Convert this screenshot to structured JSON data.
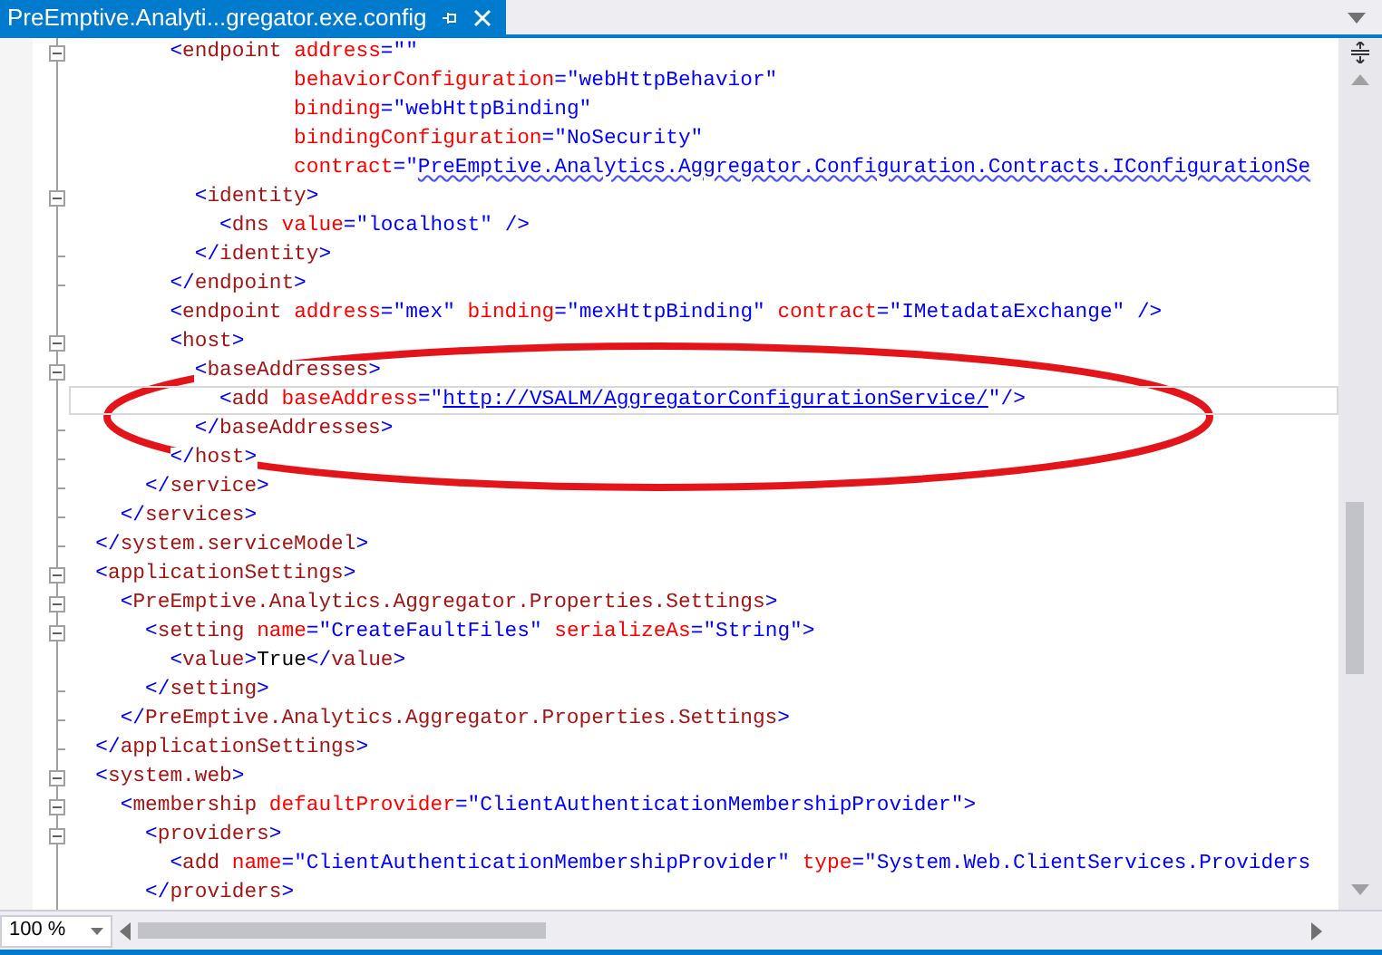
{
  "tab": {
    "title": "PreEmptive.Analyti...gregator.exe.config",
    "selected": true
  },
  "lines": [
    {
      "kind": "collapsible",
      "current": false,
      "tokens": [
        {
          "kind": "punct",
          "text": "        <"
        },
        {
          "kind": "name",
          "text": "endpoint"
        },
        {
          "kind": "attr",
          "text": " address"
        },
        {
          "kind": "punct",
          "text": "="
        },
        {
          "kind": "value",
          "text": "\"\""
        }
      ]
    },
    {
      "kind": "plain",
      "current": false,
      "tokens": [
        {
          "kind": "attr",
          "text": "                  behaviorConfiguration"
        },
        {
          "kind": "punct",
          "text": "="
        },
        {
          "kind": "value",
          "text": "\"webHttpBehavior\""
        }
      ]
    },
    {
      "kind": "plain",
      "current": false,
      "tokens": [
        {
          "kind": "attr",
          "text": "                  binding"
        },
        {
          "kind": "punct",
          "text": "="
        },
        {
          "kind": "value",
          "text": "\"webHttpBinding\""
        }
      ]
    },
    {
      "kind": "plain",
      "current": false,
      "tokens": [
        {
          "kind": "attr",
          "text": "                  bindingConfiguration"
        },
        {
          "kind": "punct",
          "text": "="
        },
        {
          "kind": "value",
          "text": "\"NoSecurity\""
        }
      ]
    },
    {
      "kind": "plain",
      "current": false,
      "tokens": [
        {
          "kind": "attr",
          "text": "                  contract"
        },
        {
          "kind": "punct",
          "text": "="
        },
        {
          "kind": "value",
          "text": "\""
        },
        {
          "kind": "error",
          "text": "PreEmptive.Analytics.Aggregator.Configuration.Contracts.IConfigurationSe"
        }
      ]
    },
    {
      "kind": "collapsible",
      "current": false,
      "tokens": [
        {
          "kind": "punct",
          "text": "          <"
        },
        {
          "kind": "name",
          "text": "identity"
        },
        {
          "kind": "punct",
          "text": ">"
        }
      ]
    },
    {
      "kind": "plain",
      "current": false,
      "tokens": [
        {
          "kind": "punct",
          "text": "            <"
        },
        {
          "kind": "name",
          "text": "dns"
        },
        {
          "kind": "attr",
          "text": " value"
        },
        {
          "kind": "punct",
          "text": "="
        },
        {
          "kind": "value",
          "text": "\"localhost\""
        },
        {
          "kind": "punct",
          "text": " />"
        }
      ]
    },
    {
      "kind": "closing",
      "current": false,
      "tokens": [
        {
          "kind": "punct",
          "text": "          </"
        },
        {
          "kind": "name",
          "text": "identity"
        },
        {
          "kind": "punct",
          "text": ">"
        }
      ]
    },
    {
      "kind": "closing",
      "current": false,
      "tokens": [
        {
          "kind": "punct",
          "text": "        </"
        },
        {
          "kind": "name",
          "text": "endpoint"
        },
        {
          "kind": "punct",
          "text": ">"
        }
      ]
    },
    {
      "kind": "plain",
      "current": false,
      "tokens": [
        {
          "kind": "punct",
          "text": "        <"
        },
        {
          "kind": "name",
          "text": "endpoint"
        },
        {
          "kind": "attr",
          "text": " address"
        },
        {
          "kind": "punct",
          "text": "="
        },
        {
          "kind": "value",
          "text": "\"mex\""
        },
        {
          "kind": "attr",
          "text": " binding"
        },
        {
          "kind": "punct",
          "text": "="
        },
        {
          "kind": "value",
          "text": "\"mexHttpBinding\""
        },
        {
          "kind": "attr",
          "text": " contract"
        },
        {
          "kind": "punct",
          "text": "="
        },
        {
          "kind": "value",
          "text": "\"IMetadataExchange\""
        },
        {
          "kind": "punct",
          "text": " />"
        }
      ]
    },
    {
      "kind": "collapsible",
      "current": false,
      "tokens": [
        {
          "kind": "punct",
          "text": "        <"
        },
        {
          "kind": "name",
          "text": "host"
        },
        {
          "kind": "punct",
          "text": ">"
        }
      ]
    },
    {
      "kind": "collapsible",
      "current": false,
      "tokens": [
        {
          "kind": "punct",
          "text": "          <"
        },
        {
          "kind": "name",
          "text": "baseAddresses"
        },
        {
          "kind": "punct",
          "text": ">"
        }
      ]
    },
    {
      "kind": "plain",
      "current": true,
      "tokens": [
        {
          "kind": "punct",
          "text": "            <"
        },
        {
          "kind": "name",
          "text": "add"
        },
        {
          "kind": "attr",
          "text": " baseAddress"
        },
        {
          "kind": "punct",
          "text": "="
        },
        {
          "kind": "value",
          "text": "\""
        },
        {
          "kind": "link",
          "text": "http://VSALM/AggregatorConfigurationService/"
        },
        {
          "kind": "value",
          "text": "\""
        },
        {
          "kind": "punct",
          "text": "/>"
        }
      ]
    },
    {
      "kind": "closing",
      "current": false,
      "tokens": [
        {
          "kind": "punct",
          "text": "          </"
        },
        {
          "kind": "name",
          "text": "baseAddresses"
        },
        {
          "kind": "punct",
          "text": ">"
        }
      ]
    },
    {
      "kind": "closing",
      "current": false,
      "tokens": [
        {
          "kind": "punct",
          "text": "        </"
        },
        {
          "kind": "name",
          "text": "host"
        },
        {
          "kind": "punct",
          "text": ">"
        }
      ]
    },
    {
      "kind": "closing",
      "current": false,
      "tokens": [
        {
          "kind": "punct",
          "text": "      </"
        },
        {
          "kind": "name",
          "text": "service"
        },
        {
          "kind": "punct",
          "text": ">"
        }
      ]
    },
    {
      "kind": "closing",
      "current": false,
      "tokens": [
        {
          "kind": "punct",
          "text": "    </"
        },
        {
          "kind": "name",
          "text": "services"
        },
        {
          "kind": "punct",
          "text": ">"
        }
      ]
    },
    {
      "kind": "closing",
      "current": false,
      "tokens": [
        {
          "kind": "punct",
          "text": "  </"
        },
        {
          "kind": "name",
          "text": "system.serviceModel"
        },
        {
          "kind": "punct",
          "text": ">"
        }
      ]
    },
    {
      "kind": "collapsible",
      "current": false,
      "tokens": [
        {
          "kind": "punct",
          "text": "  <"
        },
        {
          "kind": "name",
          "text": "applicationSettings"
        },
        {
          "kind": "punct",
          "text": ">"
        }
      ]
    },
    {
      "kind": "collapsible",
      "current": false,
      "tokens": [
        {
          "kind": "punct",
          "text": "    <"
        },
        {
          "kind": "name",
          "text": "PreEmptive.Analytics.Aggregator.Properties.Settings"
        },
        {
          "kind": "punct",
          "text": ">"
        }
      ]
    },
    {
      "kind": "collapsible",
      "current": false,
      "tokens": [
        {
          "kind": "punct",
          "text": "      <"
        },
        {
          "kind": "name",
          "text": "setting"
        },
        {
          "kind": "attr",
          "text": " name"
        },
        {
          "kind": "punct",
          "text": "="
        },
        {
          "kind": "value",
          "text": "\"CreateFaultFiles\""
        },
        {
          "kind": "attr",
          "text": " serializeAs"
        },
        {
          "kind": "punct",
          "text": "="
        },
        {
          "kind": "value",
          "text": "\"String\""
        },
        {
          "kind": "punct",
          "text": ">"
        }
      ]
    },
    {
      "kind": "plain",
      "current": false,
      "tokens": [
        {
          "kind": "punct",
          "text": "        <"
        },
        {
          "kind": "name",
          "text": "value"
        },
        {
          "kind": "punct",
          "text": ">"
        },
        {
          "kind": "text",
          "text": "True"
        },
        {
          "kind": "punct",
          "text": "</"
        },
        {
          "kind": "name",
          "text": "value"
        },
        {
          "kind": "punct",
          "text": ">"
        }
      ]
    },
    {
      "kind": "closing",
      "current": false,
      "tokens": [
        {
          "kind": "punct",
          "text": "      </"
        },
        {
          "kind": "name",
          "text": "setting"
        },
        {
          "kind": "punct",
          "text": ">"
        }
      ]
    },
    {
      "kind": "closing",
      "current": false,
      "tokens": [
        {
          "kind": "punct",
          "text": "    </"
        },
        {
          "kind": "name",
          "text": "PreEmptive.Analytics.Aggregator.Properties.Settings"
        },
        {
          "kind": "punct",
          "text": ">"
        }
      ]
    },
    {
      "kind": "closing",
      "current": false,
      "tokens": [
        {
          "kind": "punct",
          "text": "  </"
        },
        {
          "kind": "name",
          "text": "applicationSettings"
        },
        {
          "kind": "punct",
          "text": ">"
        }
      ]
    },
    {
      "kind": "collapsible",
      "current": false,
      "tokens": [
        {
          "kind": "punct",
          "text": "  <"
        },
        {
          "kind": "name",
          "text": "system.web"
        },
        {
          "kind": "punct",
          "text": ">"
        }
      ]
    },
    {
      "kind": "collapsible",
      "current": false,
      "tokens": [
        {
          "kind": "punct",
          "text": "    <"
        },
        {
          "kind": "name",
          "text": "membership"
        },
        {
          "kind": "attr",
          "text": " defaultProvider"
        },
        {
          "kind": "punct",
          "text": "="
        },
        {
          "kind": "value",
          "text": "\"ClientAuthenticationMembershipProvider\""
        },
        {
          "kind": "punct",
          "text": ">"
        }
      ]
    },
    {
      "kind": "collapsible",
      "current": false,
      "tokens": [
        {
          "kind": "punct",
          "text": "      <"
        },
        {
          "kind": "name",
          "text": "providers"
        },
        {
          "kind": "punct",
          "text": ">"
        }
      ]
    },
    {
      "kind": "plain",
      "current": false,
      "tokens": [
        {
          "kind": "punct",
          "text": "        <"
        },
        {
          "kind": "name",
          "text": "add"
        },
        {
          "kind": "attr",
          "text": " name"
        },
        {
          "kind": "punct",
          "text": "="
        },
        {
          "kind": "value",
          "text": "\"ClientAuthenticationMembershipProvider\""
        },
        {
          "kind": "attr",
          "text": " type"
        },
        {
          "kind": "punct",
          "text": "="
        },
        {
          "kind": "value",
          "text": "\"System.Web.ClientServices.Providers"
        }
      ]
    },
    {
      "kind": "plain",
      "current": false,
      "tokens": [
        {
          "kind": "punct",
          "text": "      </"
        },
        {
          "kind": "name",
          "text": "providers"
        },
        {
          "kind": "punct",
          "text": ">"
        }
      ]
    }
  ],
  "zoom": {
    "value": "100 %"
  }
}
